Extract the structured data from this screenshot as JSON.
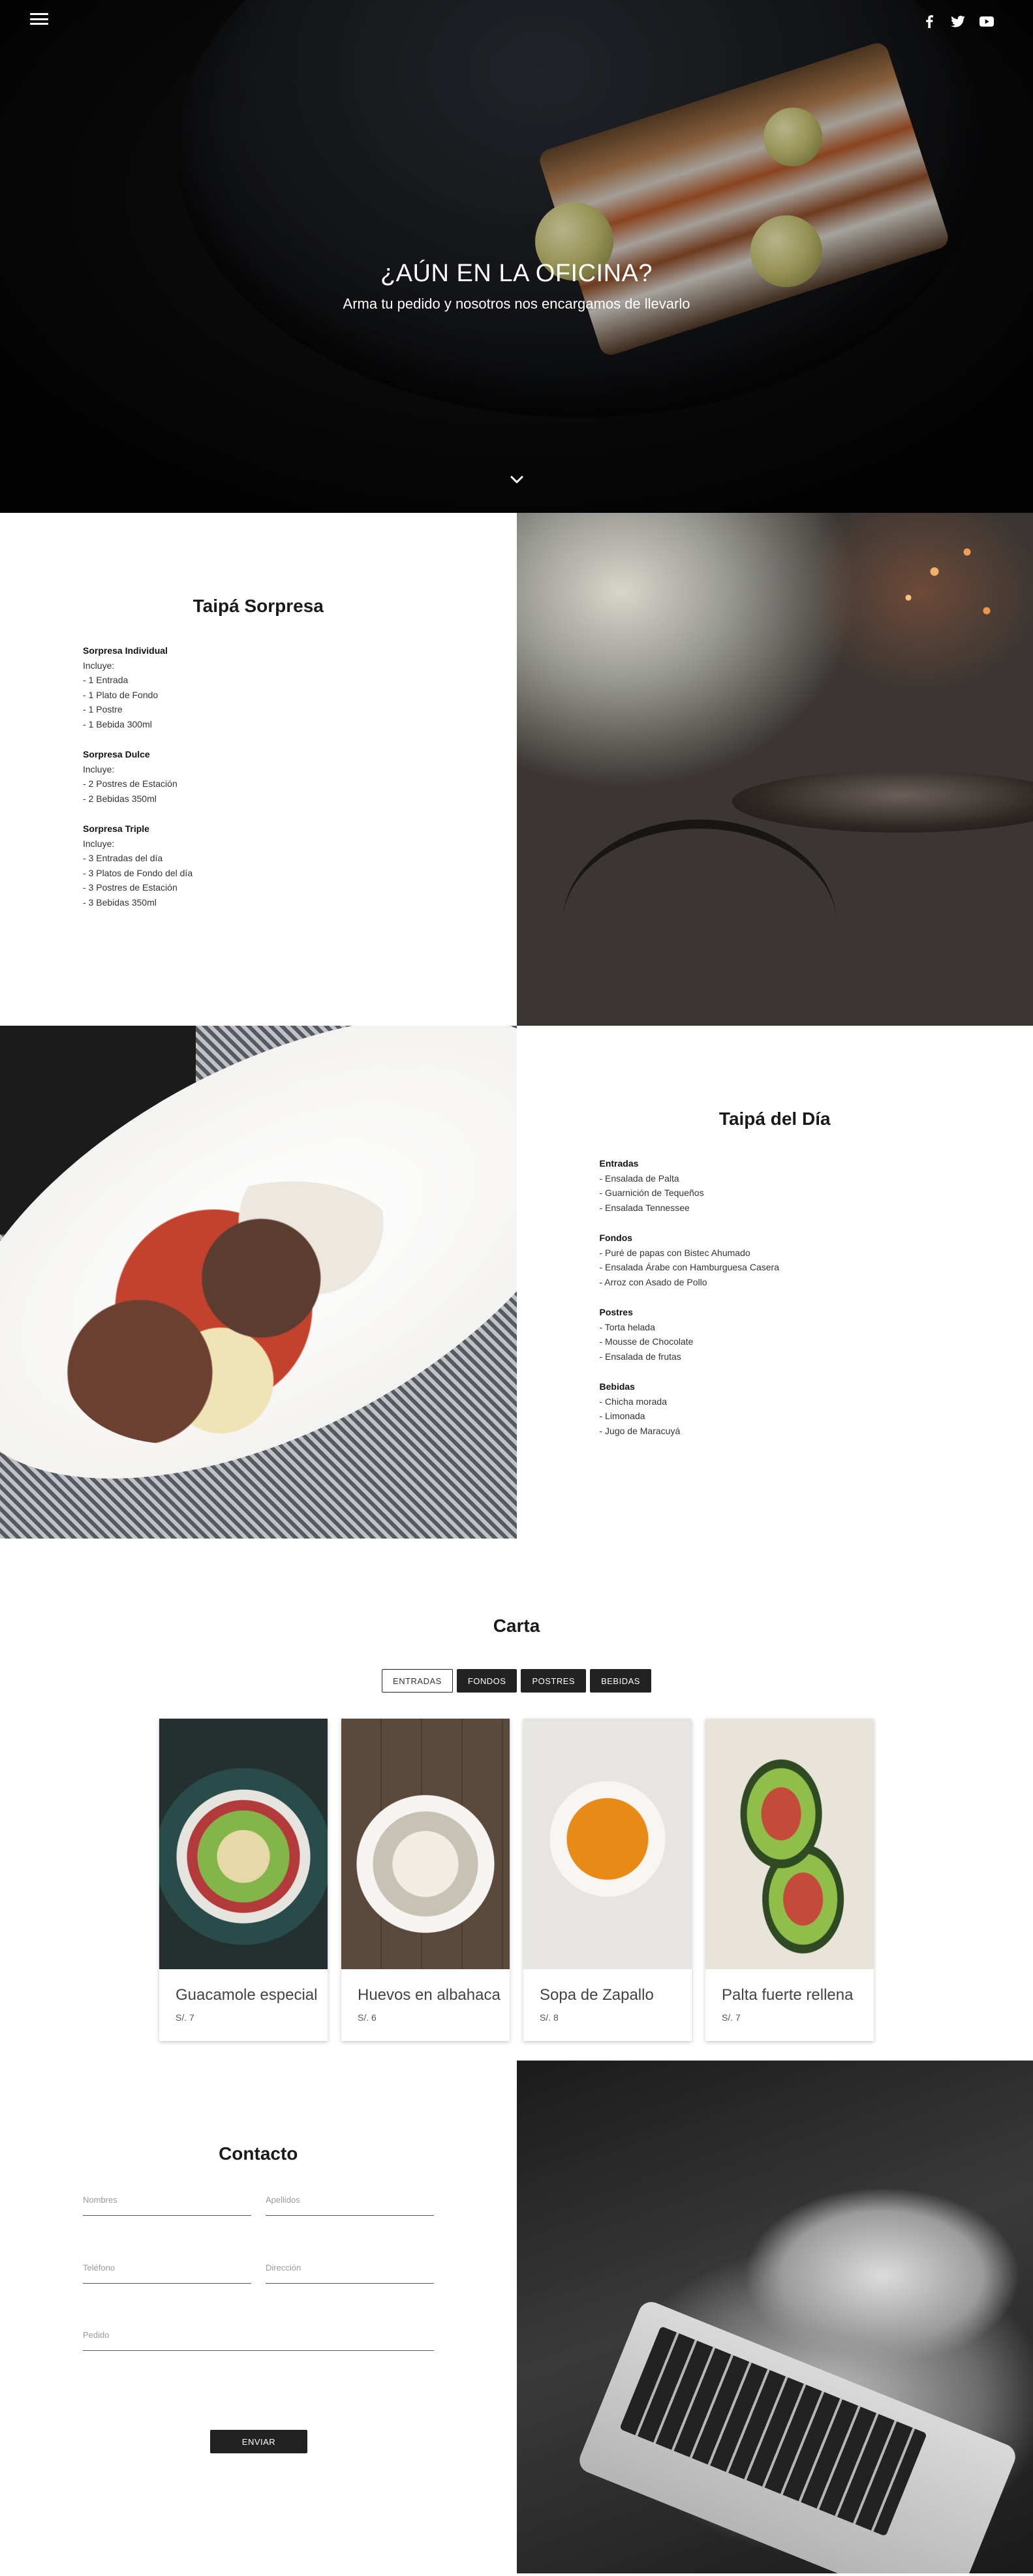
{
  "header": {
    "menu_icon": "hamburger-menu-icon",
    "social_icons": [
      "facebook-icon",
      "twitter-icon",
      "youtube-icon"
    ]
  },
  "hero": {
    "title": "¿AÚN EN LA OFICINA?",
    "subtitle": "Arma tu pedido y nosotros nos encargamos de llevarlo",
    "scroll_icon": "chevron-down-icon"
  },
  "sorpresa": {
    "title": "Taipá Sorpresa",
    "blocks": [
      {
        "heading": "Sorpresa Individual",
        "intro": "Incluye:",
        "items": [
          "- 1 Entrada",
          "- 1 Plato de Fondo",
          "- 1 Postre",
          "- 1 Bebida 300ml"
        ]
      },
      {
        "heading": "Sorpresa Dulce",
        "intro": "Incluye:",
        "items": [
          "- 2 Postres de Estación",
          "- 2 Bebidas 350ml"
        ]
      },
      {
        "heading": "Sorpresa Triple",
        "intro": "Incluye:",
        "items": [
          "- 3 Entradas del día",
          "- 3 Platos de Fondo del día",
          "- 3 Postres de Estación",
          "- 3 Bebidas 350ml"
        ]
      }
    ]
  },
  "dia": {
    "title": "Taipá del Día",
    "blocks": [
      {
        "heading": "Entradas",
        "items": [
          "- Ensalada de Palta",
          "- Guarnición de Tequeños",
          "- Ensalada Tennessee"
        ]
      },
      {
        "heading": "Fondos",
        "items": [
          "- Puré de papas con Bistec Ahumado",
          "- Ensalada Árabe con Hamburguesa Casera",
          "- Arroz con Asado de Pollo"
        ]
      },
      {
        "heading": "Postres",
        "items": [
          "- Torta helada",
          "- Mousse de Chocolate",
          "- Ensalada de frutas"
        ]
      },
      {
        "heading": "Bebidas",
        "items": [
          "- Chicha morada",
          "- Limonada",
          "- Jugo de Maracuyá"
        ]
      }
    ]
  },
  "carta": {
    "title": "Carta",
    "tabs": [
      "ENTRADAS",
      "FONDOS",
      "POSTRES",
      "BEBIDAS"
    ],
    "active_tab": "ENTRADAS",
    "items": [
      {
        "name": "Guacamole especial",
        "price": "S/. 7"
      },
      {
        "name": "Huevos en albahaca",
        "price": "S/. 6"
      },
      {
        "name": "Sopa de Zapallo",
        "price": "S/. 8"
      },
      {
        "name": "Palta fuerte rellena",
        "price": "S/. 7"
      }
    ]
  },
  "contact": {
    "title": "Contacto",
    "fields": {
      "nombres": "Nombres",
      "apellidos": "Apellidos",
      "telefono": "Teléfono",
      "direccion": "Dirección",
      "pedido": "Pedido"
    },
    "submit_label": "ENVIAR"
  },
  "colors": {
    "dark": "#222222",
    "text": "#333333",
    "white": "#ffffff"
  }
}
